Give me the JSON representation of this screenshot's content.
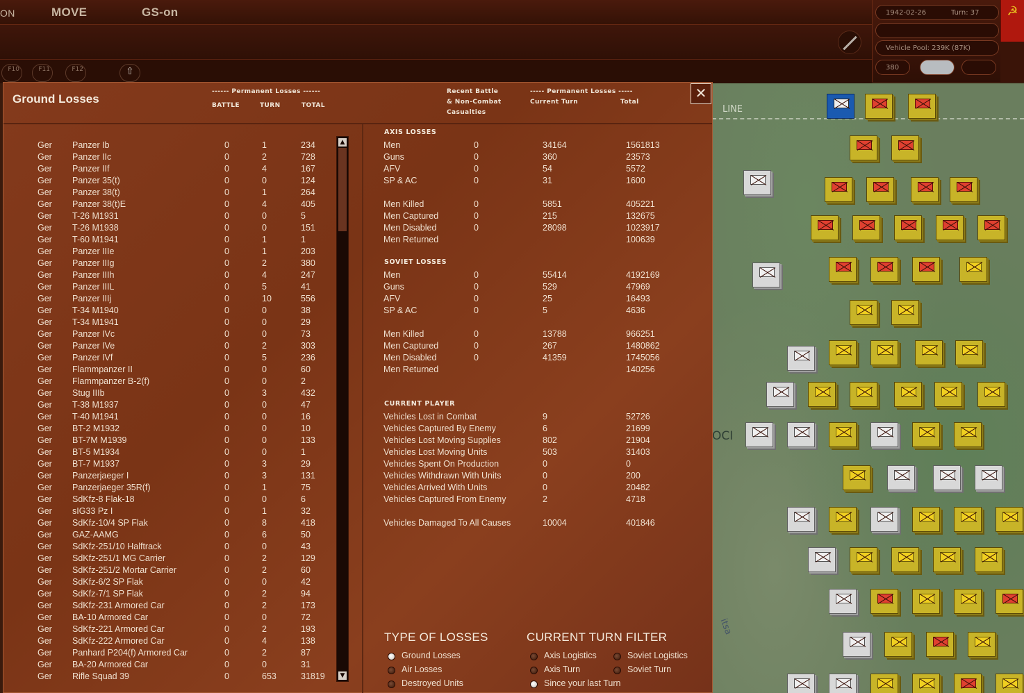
{
  "topbar": {
    "mode_left": "ON",
    "move": "MOVE",
    "gs": "GS-on"
  },
  "toolbar": {
    "f10": "F10",
    "f11": "F11",
    "f12": "F12"
  },
  "status": {
    "date": "1942-02-26",
    "turn": "Turn: 37",
    "vehicle_pool": "Vehicle Pool: 239K (87K)",
    "value_380": "380"
  },
  "map": {
    "line_label": "LINE",
    "place_fragment": "OCI",
    "river_fragment": "itsa"
  },
  "panel": {
    "title": "Ground Losses",
    "hdr_perm_left": "------ Permanent Losses ------",
    "hdr_battle": "BATTLE",
    "hdr_turn": "TURN",
    "hdr_total": "TOTAL",
    "hdr_recent_1": "Recent Battle",
    "hdr_recent_2": "& Non-Combat",
    "hdr_recent_3": "Casualties",
    "hdr_perm_right": "----- Permanent Losses -----",
    "hdr_current_turn": "Current Turn",
    "hdr_total_right": "Total",
    "close": "✕"
  },
  "equipment_rows": [
    [
      "Ger",
      "Panzer Ib",
      "0",
      "1",
      "234"
    ],
    [
      "Ger",
      "Panzer IIc",
      "0",
      "2",
      "728"
    ],
    [
      "Ger",
      "Panzer IIf",
      "0",
      "4",
      "167"
    ],
    [
      "Ger",
      "Panzer 35(t)",
      "0",
      "0",
      "124"
    ],
    [
      "Ger",
      "Panzer 38(t)",
      "0",
      "1",
      "264"
    ],
    [
      "Ger",
      "Panzer 38(t)E",
      "0",
      "4",
      "405"
    ],
    [
      "Ger",
      "T-26 M1931",
      "0",
      "0",
      "5"
    ],
    [
      "Ger",
      "T-26 M1938",
      "0",
      "0",
      "151"
    ],
    [
      "Ger",
      "T-60 M1941",
      "0",
      "1",
      "1"
    ],
    [
      "Ger",
      "Panzer IIIe",
      "0",
      "1",
      "203"
    ],
    [
      "Ger",
      "Panzer IIIg",
      "0",
      "2",
      "380"
    ],
    [
      "Ger",
      "Panzer IIIh",
      "0",
      "4",
      "247"
    ],
    [
      "Ger",
      "Panzer IIIL",
      "0",
      "5",
      "41"
    ],
    [
      "Ger",
      "Panzer IIIj",
      "0",
      "10",
      "556"
    ],
    [
      "Ger",
      "T-34 M1940",
      "0",
      "0",
      "38"
    ],
    [
      "Ger",
      "T-34 M1941",
      "0",
      "0",
      "29"
    ],
    [
      "Ger",
      "Panzer IVc",
      "0",
      "0",
      "73"
    ],
    [
      "Ger",
      "Panzer IVe",
      "0",
      "2",
      "303"
    ],
    [
      "Ger",
      "Panzer IVf",
      "0",
      "5",
      "236"
    ],
    [
      "Ger",
      "Flammpanzer II",
      "0",
      "0",
      "60"
    ],
    [
      "Ger",
      "Flammpanzer B-2(f)",
      "0",
      "0",
      "2"
    ],
    [
      "Ger",
      "Stug IIIb",
      "0",
      "3",
      "432"
    ],
    [
      "Ger",
      "T-38 M1937",
      "0",
      "0",
      "47"
    ],
    [
      "Ger",
      "T-40 M1941",
      "0",
      "0",
      "16"
    ],
    [
      "Ger",
      "BT-2 M1932",
      "0",
      "0",
      "10"
    ],
    [
      "Ger",
      "BT-7M M1939",
      "0",
      "0",
      "133"
    ],
    [
      "Ger",
      "BT-5 M1934",
      "0",
      "0",
      "1"
    ],
    [
      "Ger",
      "BT-7 M1937",
      "0",
      "3",
      "29"
    ],
    [
      "Ger",
      "Panzerjaeger I",
      "0",
      "3",
      "131"
    ],
    [
      "Ger",
      "Panzerjaeger 35R(f)",
      "0",
      "1",
      "75"
    ],
    [
      "Ger",
      "SdKfz-8 Flak-18",
      "0",
      "0",
      "6"
    ],
    [
      "Ger",
      "sIG33 Pz I",
      "0",
      "1",
      "32"
    ],
    [
      "Ger",
      "SdKfz-10/4 SP Flak",
      "0",
      "8",
      "418"
    ],
    [
      "Ger",
      "GAZ-AAMG",
      "0",
      "6",
      "50"
    ],
    [
      "Ger",
      "SdKfz-251/10 Halftrack",
      "0",
      "0",
      "43"
    ],
    [
      "Ger",
      "SdKfz-251/1 MG Carrier",
      "0",
      "2",
      "129"
    ],
    [
      "Ger",
      "SdKfz-251/2 Mortar Carrier",
      "0",
      "2",
      "60"
    ],
    [
      "Ger",
      "SdKfz-6/2 SP Flak",
      "0",
      "0",
      "42"
    ],
    [
      "Ger",
      "SdKfz-7/1 SP Flak",
      "0",
      "2",
      "94"
    ],
    [
      "Ger",
      "SdKfz-231 Armored Car",
      "0",
      "2",
      "173"
    ],
    [
      "Ger",
      "BA-10 Armored Car",
      "0",
      "0",
      "72"
    ],
    [
      "Ger",
      "SdKfz-221 Armored Car",
      "0",
      "2",
      "193"
    ],
    [
      "Ger",
      "SdKfz-222 Armored Car",
      "0",
      "4",
      "138"
    ],
    [
      "Ger",
      "Panhard P204(f) Armored Car",
      "0",
      "2",
      "87"
    ],
    [
      "Ger",
      "BA-20 Armored Car",
      "0",
      "0",
      "31"
    ],
    [
      "Ger",
      "Rifle Squad 39",
      "0",
      "653",
      "31819"
    ]
  ],
  "axis": {
    "heading": "AXIS LOSSES",
    "rows": [
      [
        "Men",
        "0",
        "34164",
        "1561813"
      ],
      [
        "Guns",
        "0",
        "360",
        "23573"
      ],
      [
        "AFV",
        "0",
        "54",
        "5572"
      ],
      [
        "SP & AC",
        "0",
        "31",
        "1600"
      ]
    ],
    "rows2": [
      [
        "Men Killed",
        "0",
        "5851",
        "405221"
      ],
      [
        "Men Captured",
        "0",
        "215",
        "132675"
      ],
      [
        "Men Disabled",
        "0",
        "28098",
        "1023917"
      ],
      [
        "Men Returned",
        "",
        "",
        "100639"
      ]
    ]
  },
  "soviet": {
    "heading": "SOVIET LOSSES",
    "rows": [
      [
        "Men",
        "0",
        "55414",
        "4192169"
      ],
      [
        "Guns",
        "0",
        "529",
        "47969"
      ],
      [
        "AFV",
        "0",
        "25",
        "16493"
      ],
      [
        "SP & AC",
        "0",
        "5",
        "4636"
      ]
    ],
    "rows2": [
      [
        "Men Killed",
        "0",
        "13788",
        "966251"
      ],
      [
        "Men Captured",
        "0",
        "267",
        "1480862"
      ],
      [
        "Men Disabled",
        "0",
        "41359",
        "1745056"
      ],
      [
        "Men Returned",
        "",
        "",
        "140256"
      ]
    ]
  },
  "current_player": {
    "heading": "CURRENT PLAYER",
    "rows": [
      [
        "Vehicles Lost in Combat",
        "9",
        "52726"
      ],
      [
        "Vehicles Captured By Enemy",
        "6",
        "21699"
      ],
      [
        "Vehicles Lost Moving Supplies",
        "802",
        "21904"
      ],
      [
        "Vehicles Lost Moving Units",
        "503",
        "31403"
      ],
      [
        "Vehicles Spent On Production",
        "0",
        "0"
      ],
      [
        "Vehicles Withdrawn With Units",
        "0",
        "200"
      ],
      [
        "Vehicles Arrived With Units",
        "0",
        "20482"
      ],
      [
        "Vehicles Captured From Enemy",
        "2",
        "4718"
      ]
    ],
    "damaged": [
      "Vehicles Damaged To All Causes",
      "10004",
      "401846"
    ]
  },
  "type_of_losses": {
    "heading": "TYPE OF LOSSES",
    "options": [
      "Ground Losses",
      "Air Losses",
      "Destroyed Units"
    ],
    "selected": "Ground Losses"
  },
  "turn_filter": {
    "heading": "CURRENT TURN FILTER",
    "options": [
      "Axis Logistics",
      "Soviet Logistics",
      "Axis Turn",
      "Soviet Turn",
      "Since your last Turn"
    ],
    "selected": "Since your last Turn"
  }
}
